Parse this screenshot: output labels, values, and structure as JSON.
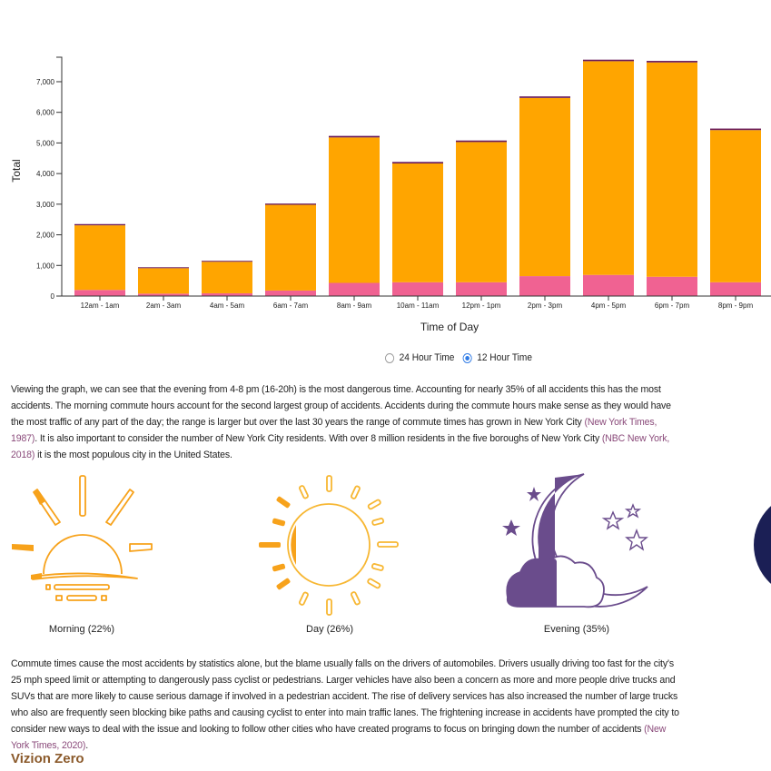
{
  "chart_data": {
    "type": "bar",
    "stacked": true,
    "categories": [
      "12am - 1am",
      "2am - 3am",
      "4am - 5am",
      "6am - 7am",
      "8am - 9am",
      "10am - 11am",
      "12pm - 1pm",
      "2pm - 3pm",
      "4pm - 5pm",
      "6pm - 7pm",
      "8pm - 9pm"
    ],
    "series": [
      {
        "color": "#f06292",
        "values": [
          200,
          80,
          90,
          180,
          430,
          450,
          450,
          650,
          690,
          630,
          450
        ]
      },
      {
        "color": "#ffa500",
        "values": [
          2110,
          830,
          1030,
          2800,
          4750,
          3880,
          4580,
          5820,
          6980,
          7000,
          4970
        ]
      },
      {
        "color": "#6a1b5a",
        "values": [
          40,
          30,
          30,
          40,
          50,
          50,
          50,
          50,
          50,
          50,
          50
        ]
      }
    ],
    "xlabel": "Time of Day",
    "ylabel": "Total",
    "yticks": [
      0,
      1000,
      2000,
      3000,
      4000,
      5000,
      6000,
      7000
    ],
    "ytick_labels": [
      "0",
      "1,000",
      "2,000",
      "3,000",
      "4,000",
      "5,000",
      "6,000",
      "7,000"
    ],
    "ylim": [
      0,
      7800
    ],
    "grid": false
  },
  "toggle": {
    "option_24": "24 Hour Time",
    "option_12": "12 Hour Time",
    "selected": "12 Hour Time"
  },
  "para1": {
    "text_a": "Viewing the graph, we can see that the evening from 4-8 pm (16-20h) is the most dangerous time. Accounting for nearly 35% of all accidents this has the most accidents. The morning commute hours account for the second largest group of accidents. Accidents during the commute hours make sense as they would have the most traffic of any part of the day; the range is larger but over the last 30 years the range of commute times has grown in New York City ",
    "link_a": "(New York Times, 1987)",
    "text_b": ". It is also important to consider the number of New York City residents. With over 8 million residents in the five boroughs of New York City ",
    "link_b": "(NBC New York, 2018)",
    "text_c": " it is the most populous city in the United States."
  },
  "icons": {
    "morning_label": "Morning (22%)",
    "day_label": "Day (26%)",
    "evening_label": "Evening (35%)"
  },
  "para2": {
    "text_a": "Commute times cause the most accidents by statistics alone, but the blame usually falls on the drivers of automobiles. Drivers usually driving too fast for the city's 25 mph speed limit or attempting to dangerously pass cyclist or pedestrians. Larger vehicles have also been a concern as more and more people drive trucks and SUVs that are more likely to cause serious damage if involved in a pedestrian accident. The rise of delivery services has also increased the number of large trucks who also are frequently seen blocking bike paths and causing cyclist to enter into main traffic lanes. The frightening increase in accidents have prompted the city to consider new ways to deal with the issue and looking to follow other cities who have created programs to focus on bringing down the number of accidents ",
    "link_a": "(New York Times, 2020)",
    "text_b": "."
  },
  "section_heading": "Vizion Zero"
}
